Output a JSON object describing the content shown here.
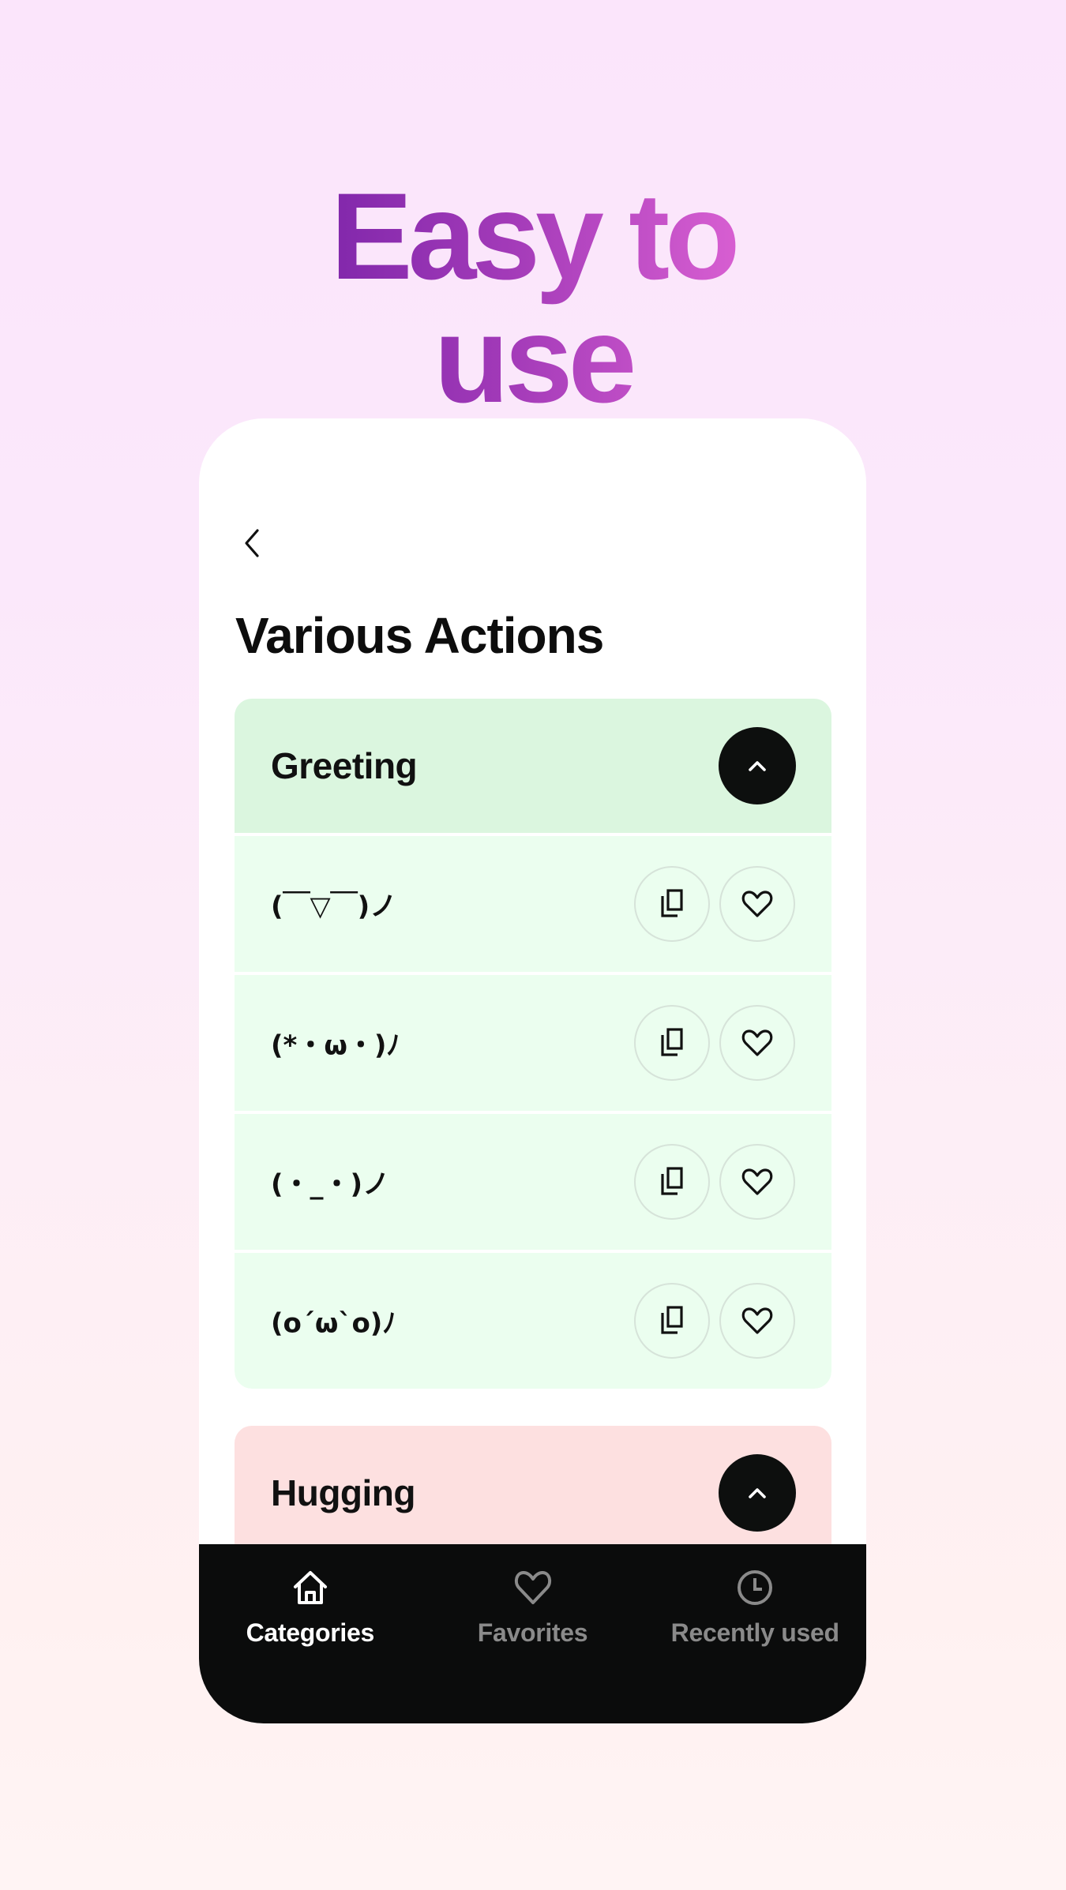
{
  "hero": {
    "title": "Easy to use",
    "gradient_start": "#7420a6",
    "gradient_end": "#e86ad9"
  },
  "screen": {
    "back_icon": "chevron-left-icon",
    "title": "Various Actions",
    "sections": [
      {
        "label": "Greeting",
        "color": "#dbf6df",
        "expanded": true,
        "toggle_icon": "chevron-up-icon",
        "items": [
          {
            "kaomoji": "(￣▽￣)ノ",
            "copy_icon": "copy-icon",
            "favorite_icon": "heart-icon"
          },
          {
            "kaomoji": "(*・ω・)ﾉ",
            "copy_icon": "copy-icon",
            "favorite_icon": "heart-icon"
          },
          {
            "kaomoji": "(・_・)ノ",
            "copy_icon": "copy-icon",
            "favorite_icon": "heart-icon"
          },
          {
            "kaomoji": "(o´ω`o)ﾉ",
            "copy_icon": "copy-icon",
            "favorite_icon": "heart-icon"
          }
        ]
      },
      {
        "label": "Hugging",
        "color": "#fde0e0",
        "toggle_icon": "chevron-up-icon"
      }
    ]
  },
  "bottom_nav": {
    "items": [
      {
        "label": "Categories",
        "icon": "home-icon",
        "active": true
      },
      {
        "label": "Favorites",
        "icon": "heart-icon",
        "active": false
      },
      {
        "label": "Recently used",
        "icon": "clock-icon",
        "active": false
      }
    ],
    "active_color": "#ffffff",
    "inactive_color": "#8a8a8a"
  }
}
